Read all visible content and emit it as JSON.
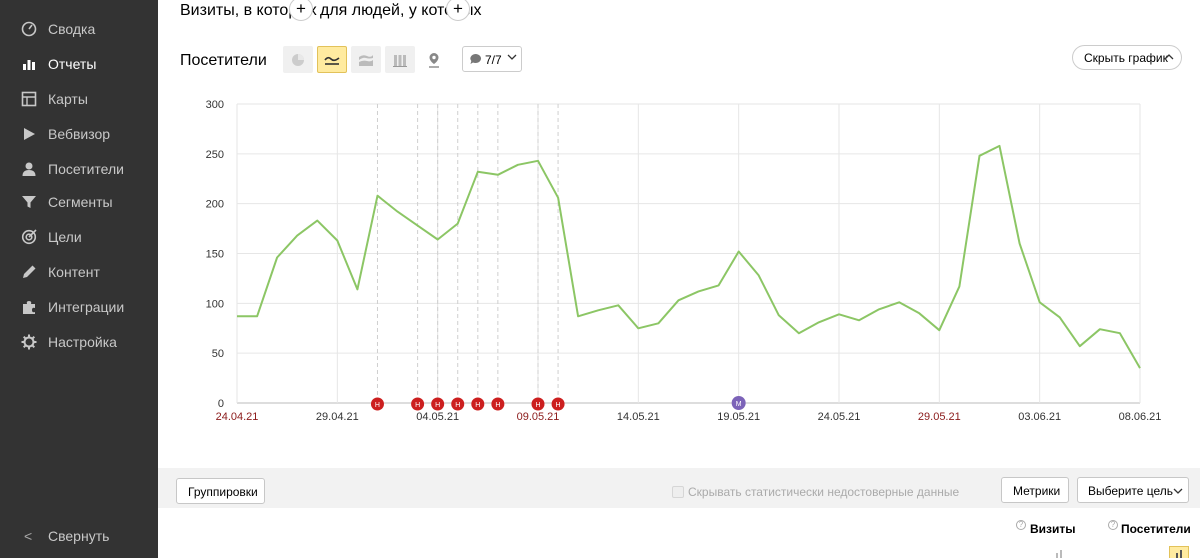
{
  "sidebar": {
    "items": [
      {
        "label": "Сводка",
        "icon": "dashboard-icon",
        "active": false
      },
      {
        "label": "Отчеты",
        "icon": "bar-chart-icon",
        "active": true
      },
      {
        "label": "Карты",
        "icon": "map-icon",
        "active": false
      },
      {
        "label": "Вебвизор",
        "icon": "play-icon",
        "active": false
      },
      {
        "label": "Посетители",
        "icon": "person-icon",
        "active": false
      },
      {
        "label": "Сегменты",
        "icon": "funnel-icon",
        "active": false
      },
      {
        "label": "Цели",
        "icon": "target-icon",
        "active": false
      },
      {
        "label": "Контент",
        "icon": "pencil-icon",
        "active": false
      },
      {
        "label": "Интеграции",
        "icon": "puzzle-icon",
        "active": false
      },
      {
        "label": "Настройка",
        "icon": "gear-icon",
        "active": false
      }
    ],
    "collapse_arrow": "<",
    "collapse_label": "Свернуть"
  },
  "filters": {
    "visits_label": "Визиты, в которых",
    "people_label": "для людей, у которых",
    "add_symbol": "+"
  },
  "chart_header": {
    "title": "Посетители",
    "view_buttons": [
      "pie-chart-icon",
      "line-chart-icon",
      "stacked-area-icon",
      "columns-icon",
      "map-pin-icon"
    ],
    "annotations_count": "7/7",
    "hide_chart_label": "Скрыть график"
  },
  "chart_data": {
    "type": "line",
    "ylim": [
      0,
      300
    ],
    "yticks": [
      "0",
      "50",
      "100",
      "150",
      "200",
      "250",
      "300"
    ],
    "xticks": [
      {
        "label": "24.04.21",
        "index": 0,
        "weekend": true
      },
      {
        "label": "29.04.21",
        "index": 5,
        "weekend": false
      },
      {
        "label": "04.05.21",
        "index": 10,
        "weekend": false
      },
      {
        "label": "09.05.21",
        "index": 15,
        "weekend": true
      },
      {
        "label": "14.05.21",
        "index": 20,
        "weekend": false
      },
      {
        "label": "19.05.21",
        "index": 25,
        "weekend": false
      },
      {
        "label": "24.05.21",
        "index": 30,
        "weekend": false
      },
      {
        "label": "29.05.21",
        "index": 35,
        "weekend": true
      },
      {
        "label": "03.06.21",
        "index": 40,
        "weekend": false
      },
      {
        "label": "08.06.21",
        "index": 45,
        "weekend": false
      }
    ],
    "series": [
      {
        "color": "#8cc665",
        "values": [
          87,
          87,
          146,
          168,
          183,
          163,
          114,
          208,
          192,
          178,
          164,
          180,
          232,
          229,
          239,
          243,
          206,
          87,
          93,
          98,
          75,
          80,
          103,
          112,
          118,
          152,
          128,
          88,
          70,
          81,
          89,
          83,
          94,
          101,
          90,
          73,
          117,
          248,
          258,
          160,
          101,
          86,
          57,
          74,
          70,
          35
        ]
      }
    ],
    "holiday_markers": [
      {
        "index": 7,
        "label": "H"
      },
      {
        "index": 9,
        "label": "H"
      },
      {
        "index": 10,
        "label": "H"
      },
      {
        "index": 11,
        "label": "H"
      },
      {
        "index": 12,
        "label": "H"
      },
      {
        "index": 13,
        "label": "H"
      },
      {
        "index": 15,
        "label": "H"
      },
      {
        "index": 16,
        "label": "H"
      }
    ],
    "event_markers": [
      {
        "index": 25,
        "label": "M"
      }
    ],
    "grid": true
  },
  "bottom": {
    "groupings_label": "Группировки",
    "hide_unreliable_label": "Скрывать статистически недостоверные данные",
    "metrics_label": "Метрики",
    "choose_goal_label": "Выберите цель",
    "columns": [
      {
        "label": "Визиты",
        "help": "?"
      },
      {
        "label": "Посетители",
        "help": "?"
      }
    ]
  },
  "colors": {
    "sidebar_bg": "#333333",
    "line": "#8cc665",
    "holiday_marker": "#cc1f1f",
    "event_marker": "#7c63b8",
    "weekend_label": "#8b1a1a",
    "selected_button": "#ffeba0"
  }
}
